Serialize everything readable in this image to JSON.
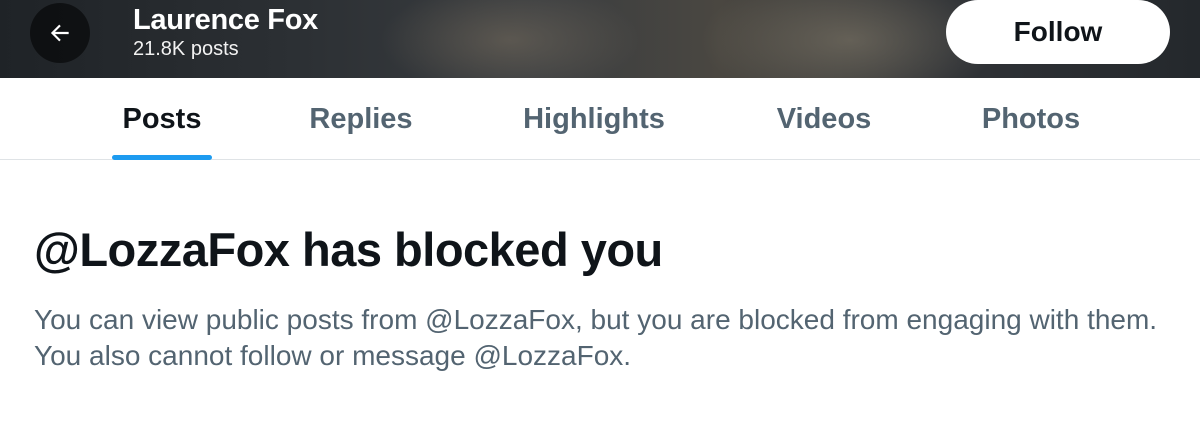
{
  "header": {
    "name": "Laurence Fox",
    "post_count": "21.8K posts",
    "back_icon": "arrow-left-icon",
    "follow_label": "Follow"
  },
  "tabs": [
    {
      "label": "Posts",
      "active": true
    },
    {
      "label": "Replies",
      "active": false
    },
    {
      "label": "Highlights",
      "active": false
    },
    {
      "label": "Videos",
      "active": false
    },
    {
      "label": "Photos",
      "active": false
    }
  ],
  "blocked": {
    "heading": "@LozzaFox has blocked you",
    "message": "You can view public posts from @LozzaFox, but you are blocked from engaging with them. You also cannot follow or message @LozzaFox."
  },
  "colors": {
    "accent": "#1d9bf0",
    "text_primary": "#0f1419",
    "text_secondary": "#536471"
  }
}
